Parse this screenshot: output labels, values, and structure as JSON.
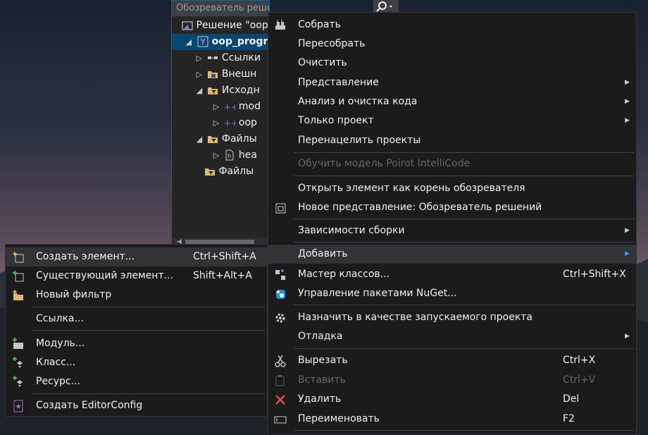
{
  "solution_explorer": {
    "search_placeholder": "Обозреватель решений — поиск (Ctrl+;",
    "tree": [
      {
        "label": "Решение \"oop"
      },
      {
        "label": "oop_progr"
      },
      {
        "label": "Ссылки"
      },
      {
        "label": "Внешн"
      },
      {
        "label": "Исходн"
      },
      {
        "label": "mod"
      },
      {
        "label": "oop"
      },
      {
        "label": "Файлы"
      },
      {
        "label": "hea"
      },
      {
        "label": "Файлы"
      }
    ]
  },
  "context_menu": {
    "items": [
      {
        "label": "Собрать",
        "icon": "build-icon"
      },
      {
        "label": "Пересобрать"
      },
      {
        "label": "Очистить"
      },
      {
        "label": "Представление",
        "submenu": true
      },
      {
        "label": "Анализ и очистка кода",
        "submenu": true
      },
      {
        "label": "Только проект",
        "submenu": true
      },
      {
        "label": "Перенацелить проекты"
      },
      {
        "label": "Обучить модель Poirot IntelliCode",
        "disabled": true
      },
      {
        "label": "Открыть элемент как корень обозревателя"
      },
      {
        "label": "Новое представление: Обозреватель решений",
        "icon": "new-view-icon"
      },
      {
        "label": "Зависимости сборки",
        "submenu": true
      },
      {
        "label": "Добавить",
        "submenu": true,
        "highlighted": true
      },
      {
        "label": "Мастер классов...",
        "shortcut": "Ctrl+Shift+X",
        "icon": "class-wizard-icon"
      },
      {
        "label": "Управление пакетами NuGet...",
        "icon": "nuget-icon"
      },
      {
        "label": "Назначить в качестве запускаемого проекта",
        "icon": "gear-icon"
      },
      {
        "label": "Отладка",
        "submenu": true
      },
      {
        "label": "Вырезать",
        "shortcut": "Ctrl+X",
        "icon": "scissors-icon"
      },
      {
        "label": "Вставить",
        "shortcut": "Ctrl+V",
        "disabled": true,
        "icon": "paste-icon"
      },
      {
        "label": "Удалить",
        "shortcut": "Del",
        "icon": "delete-icon"
      },
      {
        "label": "Переименовать",
        "shortcut": "F2",
        "icon": "rename-icon"
      }
    ]
  },
  "add_submenu": {
    "items": [
      {
        "label": "Создать элемент...",
        "shortcut": "Ctrl+Shift+A",
        "icon": "new-item-icon"
      },
      {
        "label": "Существующий элемент...",
        "shortcut": "Shift+Alt+A",
        "icon": "existing-item-icon"
      },
      {
        "label": "Новый фильтр",
        "icon": "new-filter-icon"
      },
      {
        "label": "Ссылка..."
      },
      {
        "label": "Модуль...",
        "icon": "module-icon"
      },
      {
        "label": "Класс...",
        "icon": "class-icon"
      },
      {
        "label": "Ресурс...",
        "icon": "resource-icon"
      },
      {
        "label": "Создать EditorConfig",
        "icon": "editorconfig-icon"
      }
    ]
  },
  "colors": {
    "accent": "#0e639c",
    "menu_bg": "#1b1b1c",
    "hover_bg": "#333337",
    "disabled_text": "#656565",
    "delete_icon": "#e5484d"
  }
}
